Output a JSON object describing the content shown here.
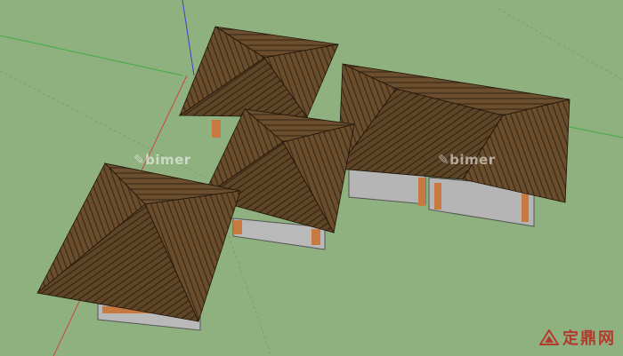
{
  "viewport": {
    "background_color": "#8fb07f",
    "roof_color": "#6b4e2d",
    "roof_dark_color": "#3c2b18",
    "wall_color": "#b6b6b6",
    "post_color": "#c8793f",
    "axis_red": "#c8473d",
    "axis_green": "#3fae3f",
    "axis_blue": "#3a44c8"
  },
  "watermarks": {
    "left": "bimer",
    "right": "bimer",
    "brand": "定鼎网"
  },
  "icons": {
    "brand_logo": "brand-logo-icon",
    "watermark": "bimer-logo-icon"
  }
}
